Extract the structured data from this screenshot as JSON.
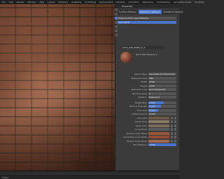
{
  "menu": [
    "File",
    "Edit",
    "Render",
    "Window",
    "Help",
    "Layout",
    "Modeling",
    "Sculpting",
    "UV Editing",
    "Texture Paint",
    "Shading",
    "Animation",
    "Rendering",
    "Compositing",
    "Geometry Nodes",
    "Scripting"
  ],
  "panel": {
    "title": "Properties",
    "tabs": [
      {
        "label": "Surface Material",
        "active": false
      },
      {
        "label": "Substance Settings",
        "active": true
      },
      {
        "label": "Substance Texture",
        "active": false
      }
    ],
    "selected_row": "Select Active: Layer Material",
    "selected_field": "Brick.sbsar",
    "material_name": "brick_wall_tilable_2_2",
    "preview_label": "Brick Wall Material 2",
    "properties": [
      {
        "label": "Output Type",
        "value": "Generate Use Resolution"
      },
      {
        "label": "Texture Format",
        "value": "PNG"
      },
      {
        "label": "Width",
        "value": "2048"
      },
      {
        "label": "Height",
        "value": "2048"
      },
      {
        "label": "Normal Format",
        "value": "DirectX/OpenGL"
      },
      {
        "label": "Random Seed",
        "value": "0"
      },
      {
        "label": "Rotation",
        "value": "Degrees 0"
      }
    ],
    "sliders": [
      {
        "label": "Height Map",
        "value": "1.000",
        "fill": 0.55
      },
      {
        "label": "Normal Strength",
        "value": "1.000",
        "fill": 0.45
      },
      {
        "label": "Dirt Level",
        "value": "0.500",
        "fill": 0.35
      },
      {
        "label": "Additional Dirt",
        "value": "0.000",
        "fill": 0.0
      }
    ],
    "colors": [
      {
        "label": "Dirt Color",
        "color": "#6b5a47"
      },
      {
        "label": "Grout Color",
        "color": "#8a7a66"
      },
      {
        "label": "Dust Color",
        "color": "#7c6e5c"
      },
      {
        "label": "Grout Mode",
        "color": "#5a5a5a"
      },
      {
        "label": "Primary Color Mode",
        "color": "#9a5638"
      },
      {
        "label": "Secondary Color Mode",
        "color": "#8d4c33"
      },
      {
        "label": "Tertiary Color Mode",
        "color": "#a2694a"
      }
    ],
    "footer_label": "Tone Balance",
    "footer_value": "0.500"
  },
  "statusbar": {
    "left": "Select",
    "mid": "Pan View"
  }
}
